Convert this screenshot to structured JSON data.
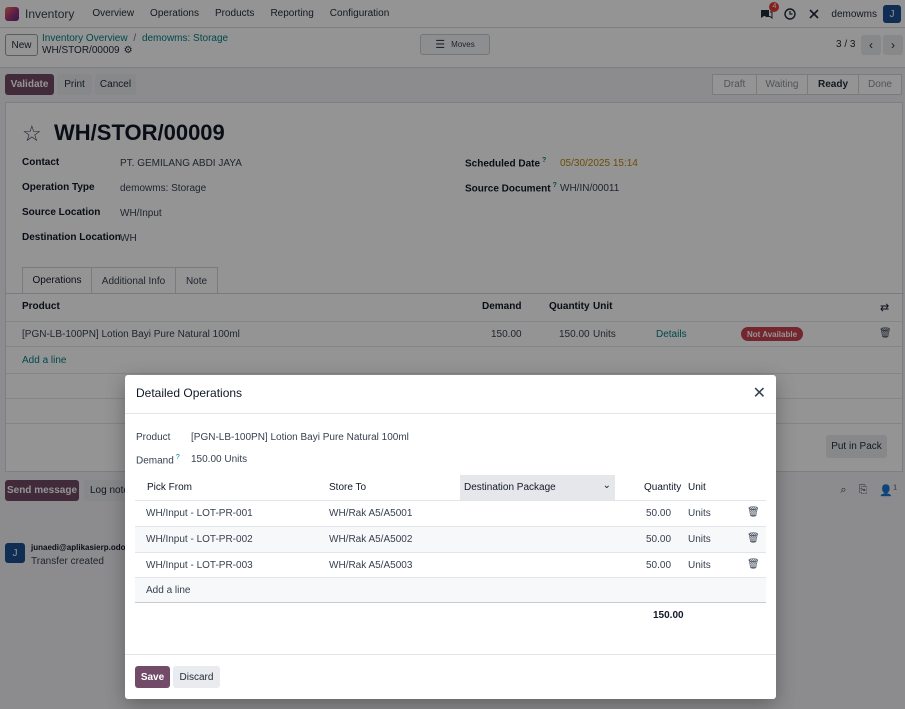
{
  "navbar": {
    "app_name": "Inventory",
    "menu": [
      "Overview",
      "Operations",
      "Products",
      "Reporting",
      "Configuration"
    ],
    "chat_count": "4",
    "db_name": "demowms",
    "user_initial": "J",
    "icons": [
      "chat-icon",
      "clock-icon",
      "tools-icon"
    ]
  },
  "control": {
    "new_label": "New",
    "breadcrumb_parent": "Inventory Overview",
    "breadcrumb_separator": "/",
    "breadcrumb_current": "demowms: Storage",
    "record_ref": "WH/STOR/00009",
    "moves_label": "Moves",
    "pager": "3 / 3"
  },
  "actions": {
    "validate": "Validate",
    "print": "Print",
    "cancel": "Cancel",
    "stages": [
      "Draft",
      "Waiting",
      "Ready",
      "Done"
    ],
    "active_stage": "Ready"
  },
  "form": {
    "title": "WH/STOR/00009",
    "fields_left": [
      {
        "label": "Contact",
        "value": "PT. GEMILANG ABDI JAYA"
      },
      {
        "label": "Operation Type",
        "value": "demowms: Storage"
      },
      {
        "label": "Source Location",
        "value": "WH/Input"
      },
      {
        "label": "Destination Location",
        "value": "WH"
      }
    ],
    "fields_right": [
      {
        "label": "Scheduled Date",
        "value": "05/30/2025 15:14"
      },
      {
        "label": "Source Document",
        "value": "WH/IN/00011"
      }
    ],
    "help_mark": "?",
    "tabs": [
      "Operations",
      "Additional Info",
      "Note"
    ],
    "op_headers": {
      "product": "Product",
      "demand": "Demand",
      "quantity": "Quantity",
      "unit": "Unit"
    },
    "op_row": {
      "product": "[PGN-LB-100PN] Lotion Bayi Pure Natural 100ml",
      "demand": "150.00",
      "quantity": "150.00",
      "unit": "Units",
      "details": "Details",
      "status": "Not Available"
    },
    "add_line": "Add a line",
    "put_in_pack": "Put in Pack"
  },
  "chatter": {
    "send_message": "Send message",
    "log_note": "Log note",
    "follower_count": "1",
    "author": "junaedi@aplikasierp.odoo",
    "author_initial": "J",
    "message": "Transfer created"
  },
  "dialog": {
    "title": "Detailed Operations",
    "product_label": "Product",
    "product_value": "[PGN-LB-100PN] Lotion Bayi Pure Natural 100ml",
    "demand_label": "Demand",
    "demand_help": "?",
    "demand_value": "150.00 Units",
    "headers": {
      "pick_from": "Pick From",
      "store_to": "Store To",
      "dest_package": "Destination Package",
      "quantity": "Quantity",
      "unit": "Unit"
    },
    "rows": [
      {
        "pick_from": "WH/Input - LOT-PR-001",
        "store_to": "WH/Rak A5/A5001",
        "quantity": "50.00",
        "unit": "Units"
      },
      {
        "pick_from": "WH/Input - LOT-PR-002",
        "store_to": "WH/Rak A5/A5002",
        "quantity": "50.00",
        "unit": "Units"
      },
      {
        "pick_from": "WH/Input - LOT-PR-003",
        "store_to": "WH/Rak A5/A5003",
        "quantity": "50.00",
        "unit": "Units"
      }
    ],
    "add_line": "Add a line",
    "total": "150.00",
    "save": "Save",
    "discard": "Discard"
  },
  "colors": {
    "primary": "#714b67",
    "link": "#017e84",
    "danger": "#c9414e",
    "date": "#b8860b"
  }
}
